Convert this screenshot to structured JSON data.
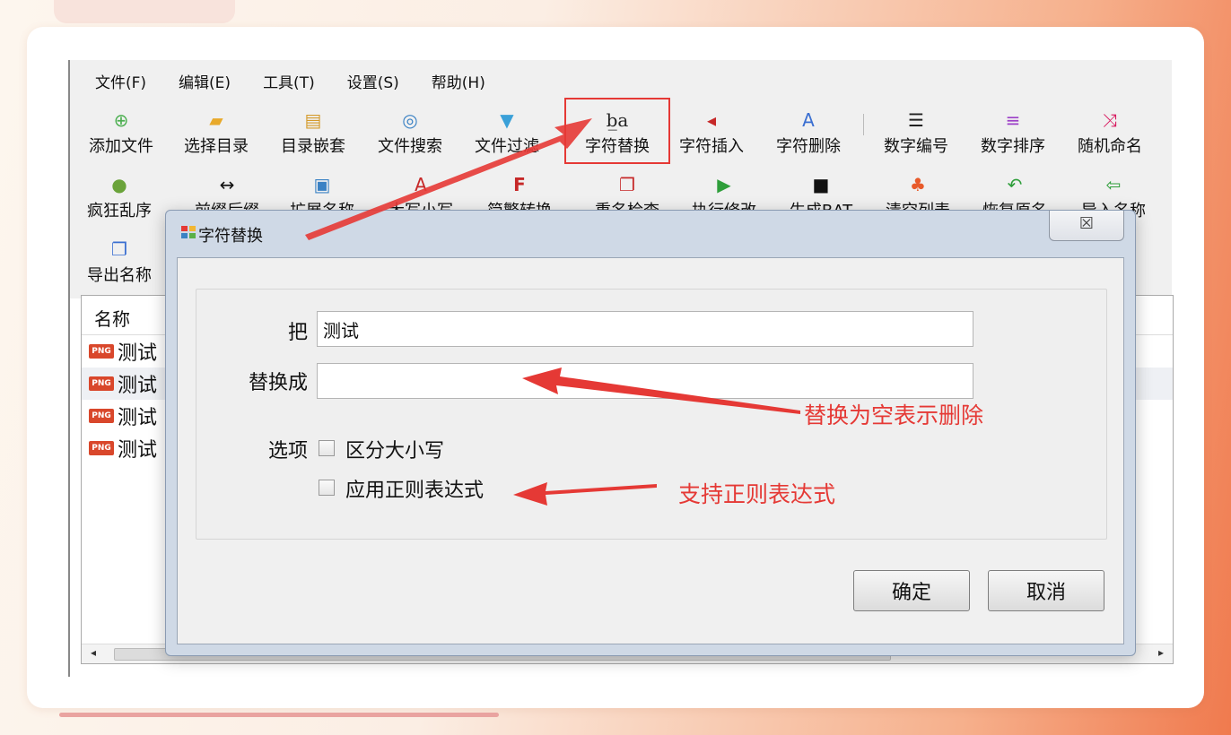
{
  "menu": [
    "文件(F)",
    "编辑(E)",
    "工具(T)",
    "设置(S)",
    "帮助(H)"
  ],
  "toolbar": {
    "row1": [
      "添加文件",
      "选择目录",
      "目录嵌套",
      "文件搜索",
      "文件过滤",
      "字符替换",
      "字符插入",
      "字符删除",
      "数字编号",
      "数字排序",
      "随机命名"
    ],
    "row2": [
      "疯狂乱序",
      "前缀后缀",
      "扩展名称",
      "大写小写",
      "简繁转换",
      "重名检查",
      "执行修改",
      "生成BAT",
      "清空列表",
      "恢复原名",
      "导入名称"
    ],
    "row3": [
      "导出名称"
    ]
  },
  "list": {
    "header": "名称",
    "rows": [
      "测试",
      "测试",
      "测试",
      "测试"
    ],
    "file_badge": "PNG"
  },
  "dialog": {
    "title": "字符替换",
    "close_symbol": "☒",
    "find_label": "把",
    "find_value": "测试",
    "replace_label": "替换成",
    "replace_value": "",
    "options_label": "选项",
    "option_case": "区分大小写",
    "option_regex": "应用正则表达式",
    "ok": "确定",
    "cancel": "取消"
  },
  "annotations": {
    "empty_means_delete": "替换为空表示删除",
    "regex_support": "支持正则表达式"
  },
  "colors": {
    "annotation_red": "#e53935",
    "dialog_frame": "#cfd9e6"
  }
}
